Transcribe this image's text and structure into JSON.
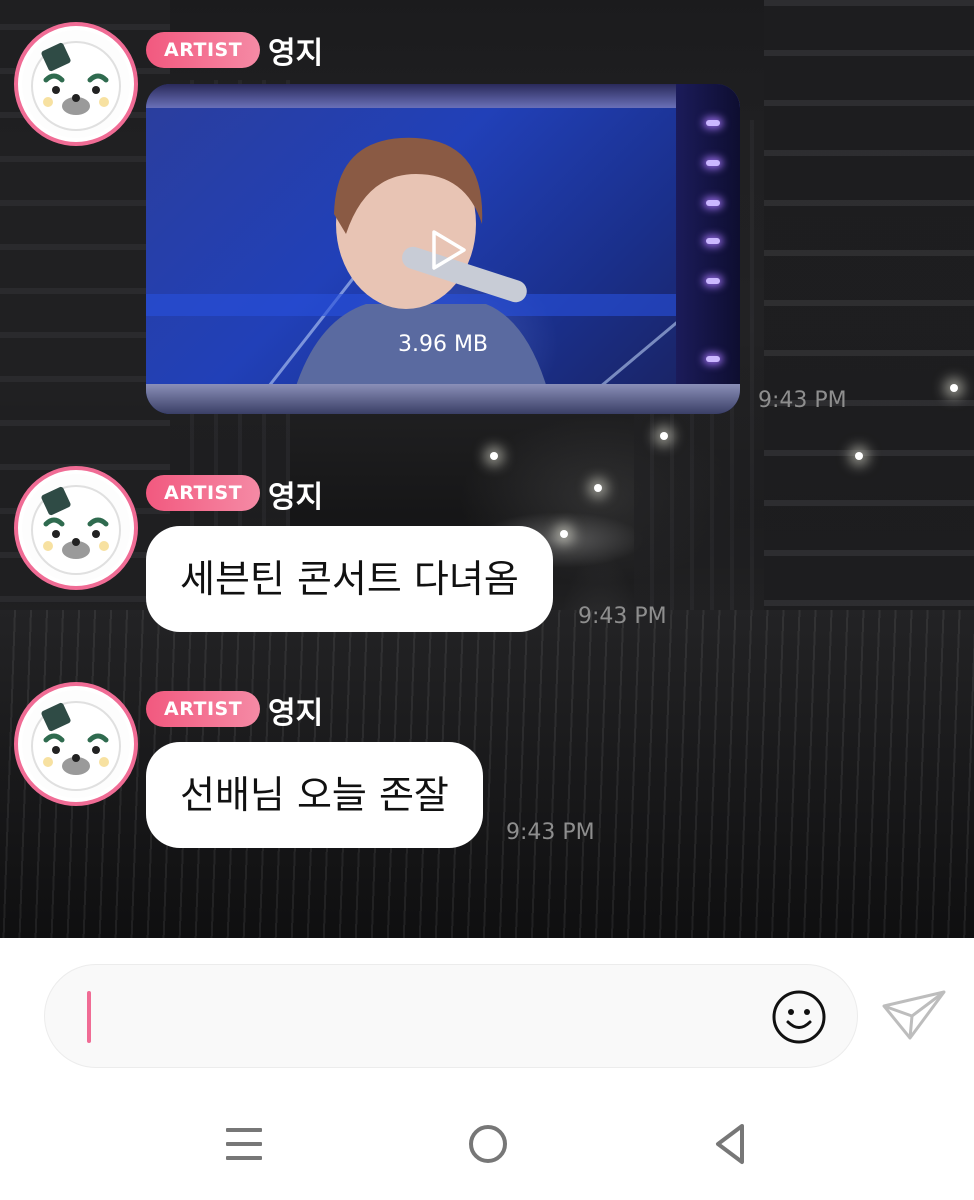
{
  "messages": [
    {
      "badge": "ARTIST",
      "sender": "영지",
      "type": "video",
      "file_size": "3.96 MB",
      "time": "9:43 PM"
    },
    {
      "badge": "ARTIST",
      "sender": "영지",
      "type": "text",
      "text": "세븐틴 콘서트 다녀옴",
      "time": "9:43 PM"
    },
    {
      "badge": "ARTIST",
      "sender": "영지",
      "type": "text",
      "text": "선배님 오늘 존잘",
      "time": "9:43 PM"
    }
  ],
  "composer": {
    "value": "",
    "placeholder": ""
  },
  "icons": {
    "avatar": "rice-ball-mascot-avatar",
    "play": "play-icon",
    "emoji": "smiley-icon",
    "send": "paper-plane-icon",
    "nav_recents": "menu-lines-icon",
    "nav_home": "home-circle-icon",
    "nav_back": "back-triangle-icon"
  },
  "colors": {
    "accent": "#f06c95",
    "badge_gradient_start": "#f2597f",
    "badge_gradient_end": "#f58aa5",
    "timestamp": "#8e8e8e",
    "bubble": "#ffffff"
  }
}
